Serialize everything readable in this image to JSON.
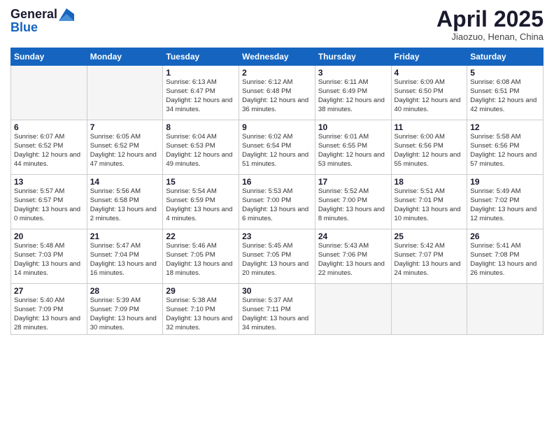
{
  "logo": {
    "line1": "General",
    "line2": "Blue"
  },
  "header": {
    "title": "April 2025",
    "subtitle": "Jiaozuo, Henan, China"
  },
  "weekdays": [
    "Sunday",
    "Monday",
    "Tuesday",
    "Wednesday",
    "Thursday",
    "Friday",
    "Saturday"
  ],
  "weeks": [
    [
      {
        "day": "",
        "empty": true
      },
      {
        "day": "",
        "empty": true
      },
      {
        "day": "1",
        "sunrise": "6:13 AM",
        "sunset": "6:47 PM",
        "daylight": "12 hours and 34 minutes."
      },
      {
        "day": "2",
        "sunrise": "6:12 AM",
        "sunset": "6:48 PM",
        "daylight": "12 hours and 36 minutes."
      },
      {
        "day": "3",
        "sunrise": "6:11 AM",
        "sunset": "6:49 PM",
        "daylight": "12 hours and 38 minutes."
      },
      {
        "day": "4",
        "sunrise": "6:09 AM",
        "sunset": "6:50 PM",
        "daylight": "12 hours and 40 minutes."
      },
      {
        "day": "5",
        "sunrise": "6:08 AM",
        "sunset": "6:51 PM",
        "daylight": "12 hours and 42 minutes."
      }
    ],
    [
      {
        "day": "6",
        "sunrise": "6:07 AM",
        "sunset": "6:52 PM",
        "daylight": "12 hours and 44 minutes."
      },
      {
        "day": "7",
        "sunrise": "6:05 AM",
        "sunset": "6:52 PM",
        "daylight": "12 hours and 47 minutes."
      },
      {
        "day": "8",
        "sunrise": "6:04 AM",
        "sunset": "6:53 PM",
        "daylight": "12 hours and 49 minutes."
      },
      {
        "day": "9",
        "sunrise": "6:02 AM",
        "sunset": "6:54 PM",
        "daylight": "12 hours and 51 minutes."
      },
      {
        "day": "10",
        "sunrise": "6:01 AM",
        "sunset": "6:55 PM",
        "daylight": "12 hours and 53 minutes."
      },
      {
        "day": "11",
        "sunrise": "6:00 AM",
        "sunset": "6:56 PM",
        "daylight": "12 hours and 55 minutes."
      },
      {
        "day": "12",
        "sunrise": "5:58 AM",
        "sunset": "6:56 PM",
        "daylight": "12 hours and 57 minutes."
      }
    ],
    [
      {
        "day": "13",
        "sunrise": "5:57 AM",
        "sunset": "6:57 PM",
        "daylight": "13 hours and 0 minutes."
      },
      {
        "day": "14",
        "sunrise": "5:56 AM",
        "sunset": "6:58 PM",
        "daylight": "13 hours and 2 minutes."
      },
      {
        "day": "15",
        "sunrise": "5:54 AM",
        "sunset": "6:59 PM",
        "daylight": "13 hours and 4 minutes."
      },
      {
        "day": "16",
        "sunrise": "5:53 AM",
        "sunset": "7:00 PM",
        "daylight": "13 hours and 6 minutes."
      },
      {
        "day": "17",
        "sunrise": "5:52 AM",
        "sunset": "7:00 PM",
        "daylight": "13 hours and 8 minutes."
      },
      {
        "day": "18",
        "sunrise": "5:51 AM",
        "sunset": "7:01 PM",
        "daylight": "13 hours and 10 minutes."
      },
      {
        "day": "19",
        "sunrise": "5:49 AM",
        "sunset": "7:02 PM",
        "daylight": "13 hours and 12 minutes."
      }
    ],
    [
      {
        "day": "20",
        "sunrise": "5:48 AM",
        "sunset": "7:03 PM",
        "daylight": "13 hours and 14 minutes."
      },
      {
        "day": "21",
        "sunrise": "5:47 AM",
        "sunset": "7:04 PM",
        "daylight": "13 hours and 16 minutes."
      },
      {
        "day": "22",
        "sunrise": "5:46 AM",
        "sunset": "7:05 PM",
        "daylight": "13 hours and 18 minutes."
      },
      {
        "day": "23",
        "sunrise": "5:45 AM",
        "sunset": "7:05 PM",
        "daylight": "13 hours and 20 minutes."
      },
      {
        "day": "24",
        "sunrise": "5:43 AM",
        "sunset": "7:06 PM",
        "daylight": "13 hours and 22 minutes."
      },
      {
        "day": "25",
        "sunrise": "5:42 AM",
        "sunset": "7:07 PM",
        "daylight": "13 hours and 24 minutes."
      },
      {
        "day": "26",
        "sunrise": "5:41 AM",
        "sunset": "7:08 PM",
        "daylight": "13 hours and 26 minutes."
      }
    ],
    [
      {
        "day": "27",
        "sunrise": "5:40 AM",
        "sunset": "7:09 PM",
        "daylight": "13 hours and 28 minutes."
      },
      {
        "day": "28",
        "sunrise": "5:39 AM",
        "sunset": "7:09 PM",
        "daylight": "13 hours and 30 minutes."
      },
      {
        "day": "29",
        "sunrise": "5:38 AM",
        "sunset": "7:10 PM",
        "daylight": "13 hours and 32 minutes."
      },
      {
        "day": "30",
        "sunrise": "5:37 AM",
        "sunset": "7:11 PM",
        "daylight": "13 hours and 34 minutes."
      },
      {
        "day": "",
        "empty": true
      },
      {
        "day": "",
        "empty": true
      },
      {
        "day": "",
        "empty": true
      }
    ]
  ]
}
